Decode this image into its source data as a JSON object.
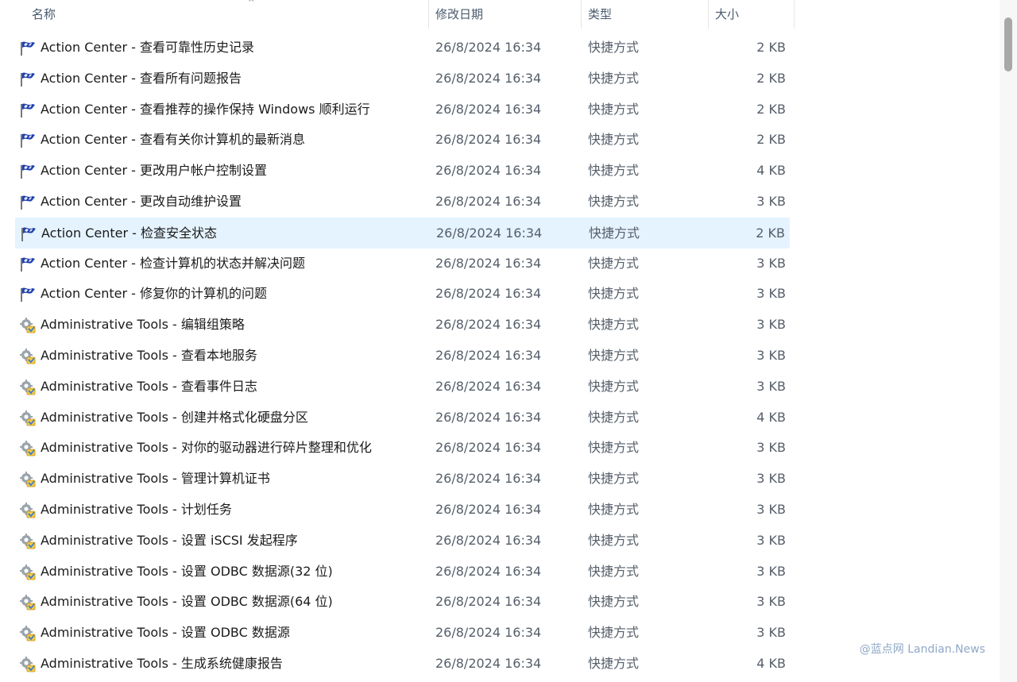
{
  "header": {
    "name": "名称",
    "date": "修改日期",
    "type": "类型",
    "size": "大小",
    "sort_arrow": "^"
  },
  "files": [
    {
      "name": "Action Center - 查看可靠性历史记录",
      "date": "26/8/2024 16:34",
      "type": "快捷方式",
      "size": "2 KB",
      "icon": "flag-icon"
    },
    {
      "name": "Action Center - 查看所有问题报告",
      "date": "26/8/2024 16:34",
      "type": "快捷方式",
      "size": "2 KB",
      "icon": "flag-icon"
    },
    {
      "name": "Action Center - 查看推荐的操作保持 Windows 顺利运行",
      "date": "26/8/2024 16:34",
      "type": "快捷方式",
      "size": "2 KB",
      "icon": "flag-icon"
    },
    {
      "name": "Action Center - 查看有关你计算机的最新消息",
      "date": "26/8/2024 16:34",
      "type": "快捷方式",
      "size": "2 KB",
      "icon": "flag-icon"
    },
    {
      "name": "Action Center - 更改用户帐户控制设置",
      "date": "26/8/2024 16:34",
      "type": "快捷方式",
      "size": "4 KB",
      "icon": "flag-icon"
    },
    {
      "name": "Action Center - 更改自动维护设置",
      "date": "26/8/2024 16:34",
      "type": "快捷方式",
      "size": "3 KB",
      "icon": "flag-icon"
    },
    {
      "name": "Action Center - 检查安全状态",
      "date": "26/8/2024 16:34",
      "type": "快捷方式",
      "size": "2 KB",
      "icon": "flag-icon",
      "selected": true
    },
    {
      "name": "Action Center - 检查计算机的状态并解决问题",
      "date": "26/8/2024 16:34",
      "type": "快捷方式",
      "size": "3 KB",
      "icon": "flag-icon"
    },
    {
      "name": "Action Center - 修复你的计算机的问题",
      "date": "26/8/2024 16:34",
      "type": "快捷方式",
      "size": "3 KB",
      "icon": "flag-icon"
    },
    {
      "name": "Administrative Tools - 编辑组策略",
      "date": "26/8/2024 16:34",
      "type": "快捷方式",
      "size": "3 KB",
      "icon": "admin-tools-icon"
    },
    {
      "name": "Administrative Tools - 查看本地服务",
      "date": "26/8/2024 16:34",
      "type": "快捷方式",
      "size": "3 KB",
      "icon": "admin-tools-icon"
    },
    {
      "name": "Administrative Tools - 查看事件日志",
      "date": "26/8/2024 16:34",
      "type": "快捷方式",
      "size": "3 KB",
      "icon": "admin-tools-icon"
    },
    {
      "name": "Administrative Tools - 创建并格式化硬盘分区",
      "date": "26/8/2024 16:34",
      "type": "快捷方式",
      "size": "4 KB",
      "icon": "admin-tools-icon"
    },
    {
      "name": "Administrative Tools - 对你的驱动器进行碎片整理和优化",
      "date": "26/8/2024 16:34",
      "type": "快捷方式",
      "size": "3 KB",
      "icon": "admin-tools-icon"
    },
    {
      "name": "Administrative Tools - 管理计算机证书",
      "date": "26/8/2024 16:34",
      "type": "快捷方式",
      "size": "3 KB",
      "icon": "admin-tools-icon"
    },
    {
      "name": "Administrative Tools - 计划任务",
      "date": "26/8/2024 16:34",
      "type": "快捷方式",
      "size": "3 KB",
      "icon": "admin-tools-icon"
    },
    {
      "name": "Administrative Tools - 设置 iSCSI 发起程序",
      "date": "26/8/2024 16:34",
      "type": "快捷方式",
      "size": "3 KB",
      "icon": "admin-tools-icon"
    },
    {
      "name": "Administrative Tools - 设置 ODBC 数据源(32 位)",
      "date": "26/8/2024 16:34",
      "type": "快捷方式",
      "size": "3 KB",
      "icon": "admin-tools-icon"
    },
    {
      "name": "Administrative Tools - 设置 ODBC 数据源(64 位)",
      "date": "26/8/2024 16:34",
      "type": "快捷方式",
      "size": "3 KB",
      "icon": "admin-tools-icon"
    },
    {
      "name": "Administrative Tools - 设置 ODBC 数据源",
      "date": "26/8/2024 16:34",
      "type": "快捷方式",
      "size": "3 KB",
      "icon": "admin-tools-icon"
    },
    {
      "name": "Administrative Tools - 生成系统健康报告",
      "date": "26/8/2024 16:34",
      "type": "快捷方式",
      "size": "4 KB",
      "icon": "admin-tools-icon"
    }
  ],
  "watermark": "@蓝点网 Landian.News",
  "colors": {
    "selected_row": "#e5f3ff",
    "header_text": "#4a5a6e",
    "secondary_text": "#555e69",
    "flag_blue": "#1f3fae"
  }
}
